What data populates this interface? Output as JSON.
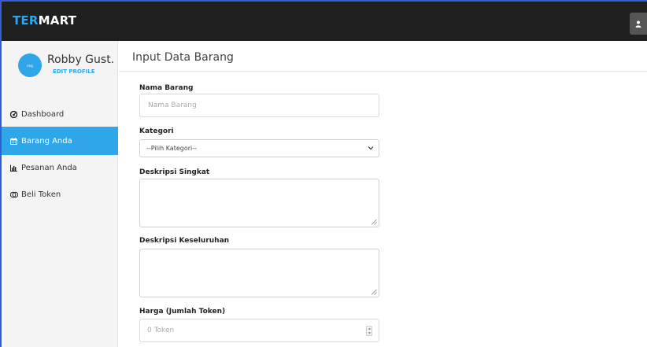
{
  "app": {
    "brand_part1": "TER",
    "brand_part2": "MART"
  },
  "profile": {
    "name": "Robby Gust...",
    "edit_label": "EDIT PROFILE",
    "avatar_text": "img"
  },
  "sidebar": {
    "items": [
      {
        "label": "Dashboard",
        "icon": "dashboard-icon"
      },
      {
        "label": "Barang Anda",
        "icon": "calendar-icon",
        "active": true
      },
      {
        "label": "Pesanan Anda",
        "icon": "bar-chart-icon"
      },
      {
        "label": "Beli Token",
        "icon": "token-icon"
      }
    ]
  },
  "form": {
    "title": "Input Data Barang",
    "nama_label": "Nama Barang",
    "nama_placeholder": "Nama Barang",
    "kategori_label": "Kategori",
    "kategori_selected": "--Pilih Kategori--",
    "deskripsi_singkat_label": "Deskripsi Singkat",
    "deskripsi_keseluruhan_label": "Deskripsi Keseluruhan",
    "harga_label": "Harga (Jumlah Token)",
    "harga_placeholder": "0 Token"
  },
  "colors": {
    "accent": "#2fa6ea",
    "topbar": "#1f1f1f",
    "sidebar_bg": "#f4f4f4"
  }
}
